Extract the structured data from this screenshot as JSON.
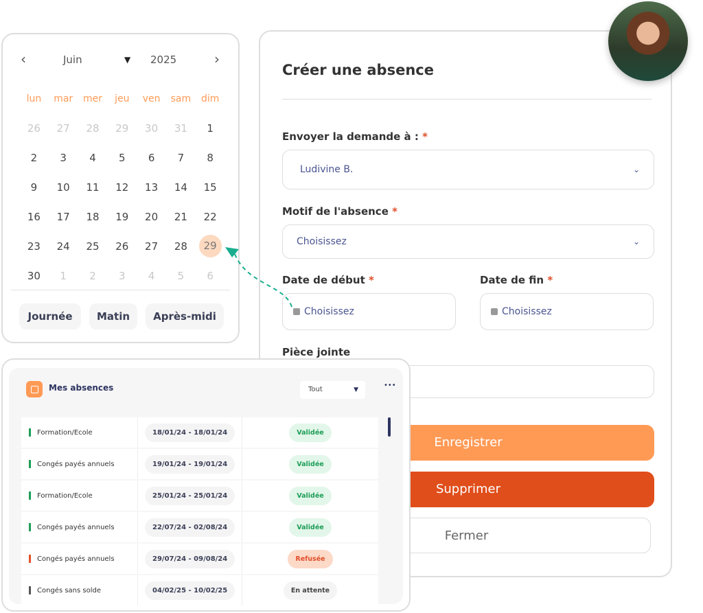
{
  "calendar": {
    "month": "Juin",
    "year": "2025",
    "prev_icon": "chevron-left-icon",
    "next_icon": "chevron-right-icon",
    "weekdays": [
      "lun",
      "mar",
      "mer",
      "jeu",
      "ven",
      "sam",
      "dim"
    ],
    "weeks": [
      [
        [
          "26",
          1
        ],
        [
          "27",
          1
        ],
        [
          "28",
          1
        ],
        [
          "29",
          1
        ],
        [
          "30",
          1
        ],
        [
          "31",
          1
        ],
        [
          "1",
          0
        ]
      ],
      [
        [
          "2",
          0
        ],
        [
          "3",
          0
        ],
        [
          "4",
          0
        ],
        [
          "5",
          0
        ],
        [
          "6",
          0
        ],
        [
          "7",
          0
        ],
        [
          "8",
          0
        ]
      ],
      [
        [
          "9",
          0
        ],
        [
          "10",
          0
        ],
        [
          "11",
          0
        ],
        [
          "12",
          0
        ],
        [
          "13",
          0
        ],
        [
          "14",
          0
        ],
        [
          "15",
          0
        ]
      ],
      [
        [
          "16",
          0
        ],
        [
          "17",
          0
        ],
        [
          "18",
          0
        ],
        [
          "19",
          0
        ],
        [
          "20",
          0
        ],
        [
          "21",
          0
        ],
        [
          "22",
          0
        ]
      ],
      [
        [
          "23",
          0
        ],
        [
          "24",
          0
        ],
        [
          "25",
          0
        ],
        [
          "26",
          0
        ],
        [
          "27",
          0
        ],
        [
          "28",
          0
        ],
        [
          "29",
          2
        ]
      ],
      [
        [
          "30",
          0
        ],
        [
          "1",
          1
        ],
        [
          "2",
          1
        ],
        [
          "3",
          1
        ],
        [
          "4",
          1
        ],
        [
          "5",
          1
        ],
        [
          "6",
          1
        ]
      ]
    ],
    "selected_day": "29",
    "periods": [
      "Journée",
      "Matin",
      "Après-midi"
    ]
  },
  "form": {
    "title": "Créer une absence",
    "recipient_label": "Envoyer la demande à :",
    "recipient_value": "Ludivine B.",
    "reason_label": "Motif de l'absence",
    "reason_value": "Choisissez",
    "start_label": "Date de début",
    "start_value": "Choisissez",
    "end_label": "Date de fin",
    "end_value": "Choisissez",
    "attachment_label": "Pièce jointe",
    "required_mark": "*",
    "save": "Enregistrer",
    "delete": "Supprimer",
    "close": "Fermer"
  },
  "colors": {
    "accent": "#FF9A55",
    "danger": "#E04E1B",
    "arrow": "#1AAE8F",
    "valid": "#1E9E57",
    "refused": "#E0502A"
  },
  "absences": {
    "title": "Mes absences",
    "filter": "Tout",
    "menu_icon": "ellipsis-icon",
    "rows": [
      {
        "type": "Formation/Ecole",
        "dates": "18/01/24 - 18/01/24",
        "status": "Validée",
        "state": "valid"
      },
      {
        "type": "Congés payés annuels",
        "dates": "19/01/24 - 19/01/24",
        "status": "Validée",
        "state": "valid"
      },
      {
        "type": "Formation/Ecole",
        "dates": "25/01/24 - 25/01/24",
        "status": "Validée",
        "state": "valid"
      },
      {
        "type": "Congés payés annuels",
        "dates": "22/07/24 - 02/08/24",
        "status": "Validée",
        "state": "valid"
      },
      {
        "type": "Congés payés annuels",
        "dates": "29/07/24 - 09/08/24",
        "status": "Refusée",
        "state": "refused"
      },
      {
        "type": "Congés sans solde",
        "dates": "04/02/25 - 10/02/25",
        "status": "En attente",
        "state": "pending"
      }
    ]
  }
}
